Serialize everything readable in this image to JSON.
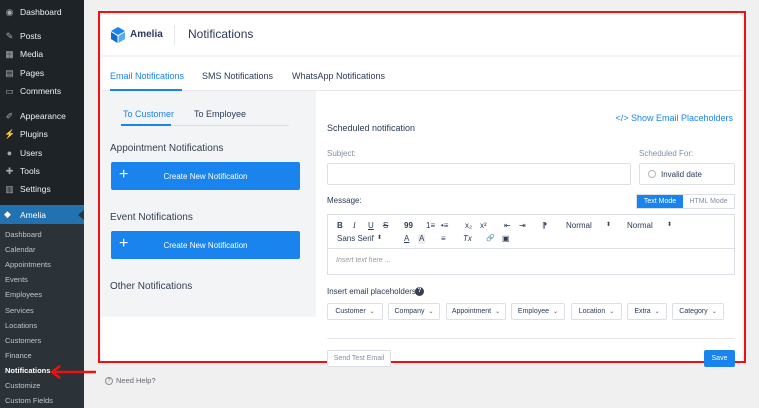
{
  "wp_menu": {
    "top_items": [
      {
        "label": "Dashboard",
        "icon": "dashboard-icon"
      },
      {
        "label": "Posts",
        "icon": "pin-icon"
      },
      {
        "label": "Media",
        "icon": "media-icon"
      },
      {
        "label": "Pages",
        "icon": "pages-icon"
      },
      {
        "label": "Comments",
        "icon": "comments-icon"
      },
      {
        "label": "Appearance",
        "icon": "brush-icon"
      },
      {
        "label": "Plugins",
        "icon": "plug-icon"
      },
      {
        "label": "Users",
        "icon": "user-icon"
      },
      {
        "label": "Tools",
        "icon": "wrench-icon"
      },
      {
        "label": "Settings",
        "icon": "settings-icon"
      }
    ],
    "amelia": {
      "label": "Amelia",
      "icon": "amelia-icon"
    },
    "sub_items": [
      "Dashboard",
      "Calendar",
      "Appointments",
      "Events",
      "Employees",
      "Services",
      "Locations",
      "Customers",
      "Finance",
      "Notifications",
      "Customize",
      "Custom Fields"
    ],
    "active_sub": "Notifications"
  },
  "header": {
    "logo_text": "Amelia",
    "title": "Notifications"
  },
  "main_tabs": [
    "Email Notifications",
    "SMS Notifications",
    "WhatsApp Notifications"
  ],
  "sub_tabs": [
    "To Customer",
    "To Employee"
  ],
  "sections": {
    "appointment": "Appointment Notifications",
    "event": "Event Notifications",
    "other": "Other Notifications",
    "create_label": "Create New Notification"
  },
  "editor_panel": {
    "title": "Scheduled notification",
    "placeholders_link": "</> Show Email Placeholders",
    "subject_label": "Subject:",
    "scheduled_label": "Scheduled For:",
    "scheduled_value": "Invalid date",
    "message_label": "Message:",
    "mode_text": "Text Mode",
    "mode_html": "HTML Mode",
    "toolbar": {
      "bold": "B",
      "italic": "I",
      "underline": "U",
      "strike": "S",
      "quote": "99",
      "ol": "1≡",
      "ul": "•≡",
      "sub": "x₂",
      "sup": "x²",
      "outdent": "⇤",
      "indent": "⇥",
      "rtl": "⁋",
      "size": "Normal",
      "header": "Normal",
      "font": "Sans Serif",
      "color": "A",
      "bg": "A",
      "align": "≡",
      "clean": "Tx",
      "link": "🔗",
      "image": "▣"
    },
    "placeholder": "Insert text here ...",
    "insert_label": "Insert email placeholders:",
    "placeholder_buttons": [
      "Customer",
      "Company",
      "Appointment",
      "Employee",
      "Location",
      "Extra",
      "Category"
    ],
    "send_test": "Send Test Email",
    "save": "Save"
  },
  "need_help": "Need Help?",
  "colors": {
    "accent": "#1a84ee",
    "highlight": "#e11"
  }
}
